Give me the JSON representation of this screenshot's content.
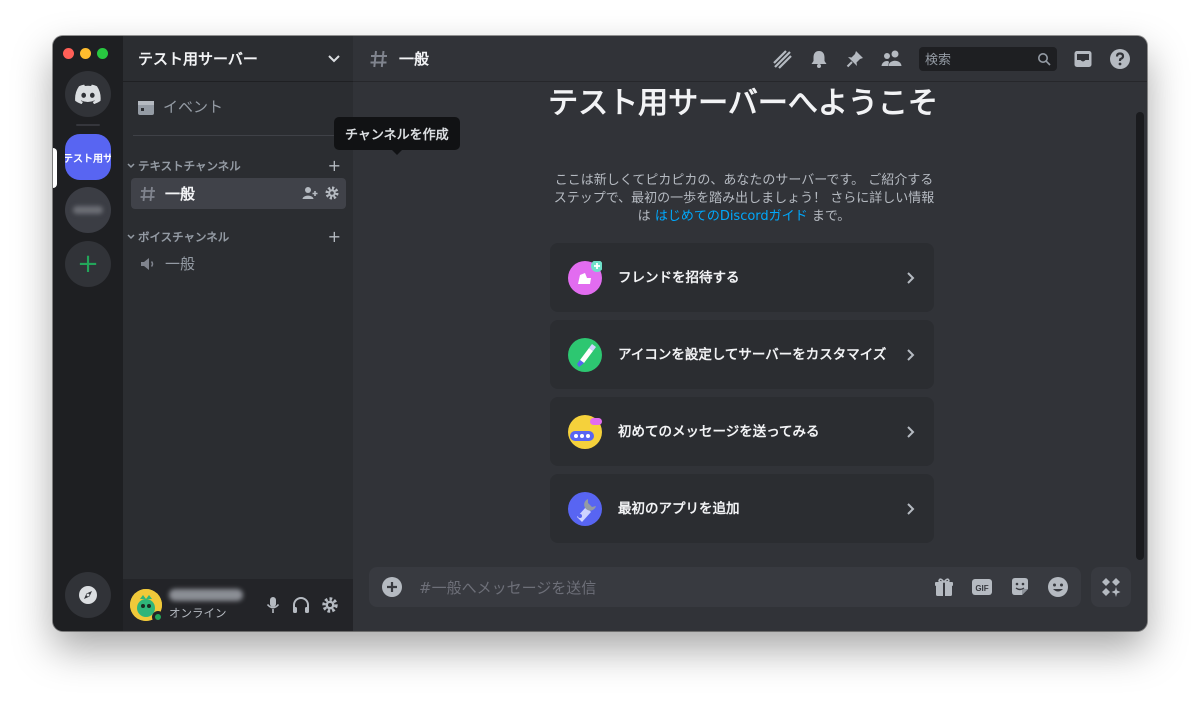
{
  "window": {
    "traffic_lights": [
      "#ff5f57",
      "#febc2e",
      "#28c840"
    ]
  },
  "rail": {
    "active_server_label": "テスト用サーバー",
    "add_server_label": "+"
  },
  "server": {
    "name": "テスト用サーバー",
    "events_label": "イベント",
    "tooltip": "チャンネルを作成",
    "categories": [
      {
        "name": "テキストチャンネル",
        "channels": [
          {
            "name": "一般"
          }
        ]
      },
      {
        "name": "ボイスチャンネル",
        "channels": [
          {
            "name": "一般"
          }
        ]
      }
    ]
  },
  "user": {
    "status": "オンライン"
  },
  "channel": {
    "name": "一般",
    "search_placeholder": "検索"
  },
  "welcome": {
    "title": "テスト用サーバーへようこそ",
    "desc_part1": "ここは新しくてピカピカの、あなたのサーバーです。 ご紹介するステップで、最初の一歩を踏み出しましょう！ さらに詳しい情報は ",
    "desc_link": "はじめてのDiscordガイド",
    "desc_part2": " まで。",
    "cards": [
      {
        "label": "フレンドを招待する",
        "icon": "invite-friends-icon",
        "color": "#e26cf0"
      },
      {
        "label": "アイコンを設定してサーバーをカスタマイズ",
        "icon": "customize-brush-icon",
        "color": "#2dc771"
      },
      {
        "label": "初めてのメッセージを送ってみる",
        "icon": "message-bubble-icon",
        "color": "#f5d13b"
      },
      {
        "label": "最初のアプリを追加",
        "icon": "add-app-icon",
        "color": "#5865f2"
      }
    ]
  },
  "composer": {
    "placeholder": "#一般へメッセージを送信",
    "gif_label": "GIF"
  },
  "colors": {
    "blurple": "#5865f2",
    "green": "#23a55a",
    "link": "#00a8fc"
  }
}
